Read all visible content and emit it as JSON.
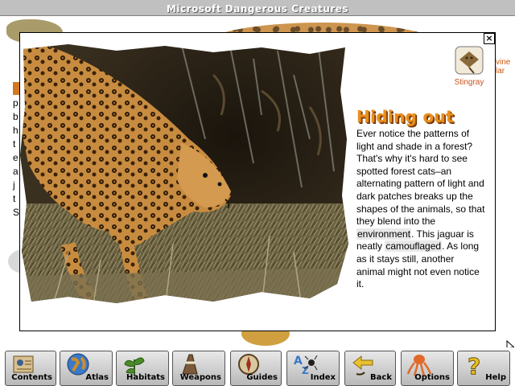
{
  "window": {
    "title": "Microsoft Dangerous Creatures"
  },
  "background": {
    "side_letters": [
      "p",
      "b",
      "h",
      "t",
      "e",
      "a",
      "j",
      "t",
      "S"
    ],
    "right_text": [
      "vine",
      "lar"
    ]
  },
  "popup": {
    "close_label": "×",
    "link": {
      "label": "Stingray",
      "icon": "stingray-icon"
    },
    "heading": "Hiding out",
    "text_before": "Ever notice the patterns of light and shade in a forest? That's why it's hard to see spotted forest cats–an alternating pattern of light and dark patches breaks up the shapes of the animals, so that they blend into the ",
    "term1": "environment",
    "text_middle": ". This jaguar is neatly ",
    "term2": "camouflaged",
    "text_after": ". As long as it stays still, another animal might not even notice it.",
    "photo": {
      "subject": "jaguar",
      "icon": "jaguar-photo"
    }
  },
  "toolbar": {
    "buttons": [
      {
        "label": "Contents",
        "icon": "contents-icon"
      },
      {
        "label": "Atlas",
        "icon": "globe-icon"
      },
      {
        "label": "Habitats",
        "icon": "plant-icon"
      },
      {
        "label": "Weapons",
        "icon": "weapons-icon"
      },
      {
        "label": "Guides",
        "icon": "compass-icon"
      },
      {
        "label": "Index",
        "icon": "index-icon"
      },
      {
        "label": "Back",
        "icon": "back-arrow-icon"
      },
      {
        "label": "Options",
        "icon": "octopus-icon"
      },
      {
        "label": "Help",
        "icon": "help-icon"
      }
    ]
  },
  "colors": {
    "heading": "#e8901e",
    "link": "#c8501e",
    "titlebar": "#c0c0c0"
  }
}
